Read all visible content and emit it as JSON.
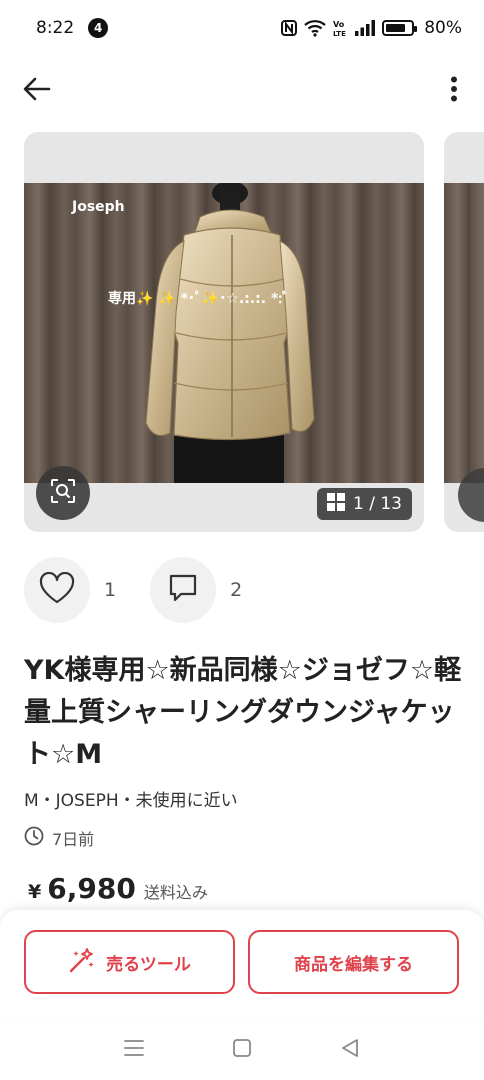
{
  "status_bar": {
    "time": "8:22",
    "notification_count": "4",
    "battery_percent": "80%",
    "battery_level": 0.8,
    "icons": [
      "nfc-icon",
      "wifi-icon",
      "volte-icon",
      "signal-icon",
      "battery-icon"
    ]
  },
  "app_bar": {
    "back_icon": "arrow-left-icon",
    "more_icon": "more-vertical-icon"
  },
  "gallery": {
    "photo_brand": "Joseph",
    "photo_caption": "専用✨ ✨ *･ﾟ✨･☆.:.:. *:ﾟ",
    "counter": "1 / 13"
  },
  "actions": {
    "likes": "1",
    "comments": "2"
  },
  "item": {
    "title": "YK様専用☆新品同様☆ジョゼフ☆軽量上質シャーリングダウンジャケット☆M",
    "meta": "M・JOSEPH・未使用に近い",
    "posted": "7日前",
    "price_currency": "¥",
    "price": "6,980",
    "shipping_note": "送料込み"
  },
  "bottom": {
    "sell_tools_label": "売るツール",
    "edit_label": "商品を編集する"
  },
  "colors": {
    "accent": "#e0424b",
    "text": "#222222",
    "card_bg": "#e6e6e6"
  }
}
